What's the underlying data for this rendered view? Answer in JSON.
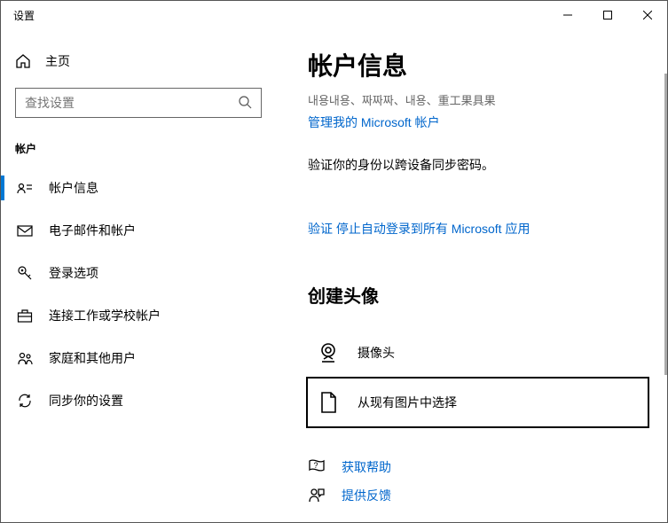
{
  "window": {
    "title": "设置"
  },
  "sidebar": {
    "home": "主页",
    "search_placeholder": "查找设置",
    "section": "帐户",
    "items": [
      {
        "label": "帐户信息"
      },
      {
        "label": "电子邮件和帐户"
      },
      {
        "label": "登录选项"
      },
      {
        "label": "连接工作或学校帐户"
      },
      {
        "label": "家庭和其他用户"
      },
      {
        "label": "同步你的设置"
      }
    ]
  },
  "main": {
    "heading": "帐户信息",
    "truncated": "내용내용、짜짜짜、내용、重工果具果",
    "manage_link": "管理我的 Microsoft 帐户",
    "verify_text": "验证你的身份以跨设备同步密码。",
    "verify_link": "验证",
    "stop_signin_link": "停止自动登录到所有 Microsoft 应用",
    "avatar_heading": "创建头像",
    "camera_option": "摄像头",
    "browse_option": "从现有图片中选择",
    "help_link": "获取帮助",
    "feedback_link": "提供反馈"
  }
}
